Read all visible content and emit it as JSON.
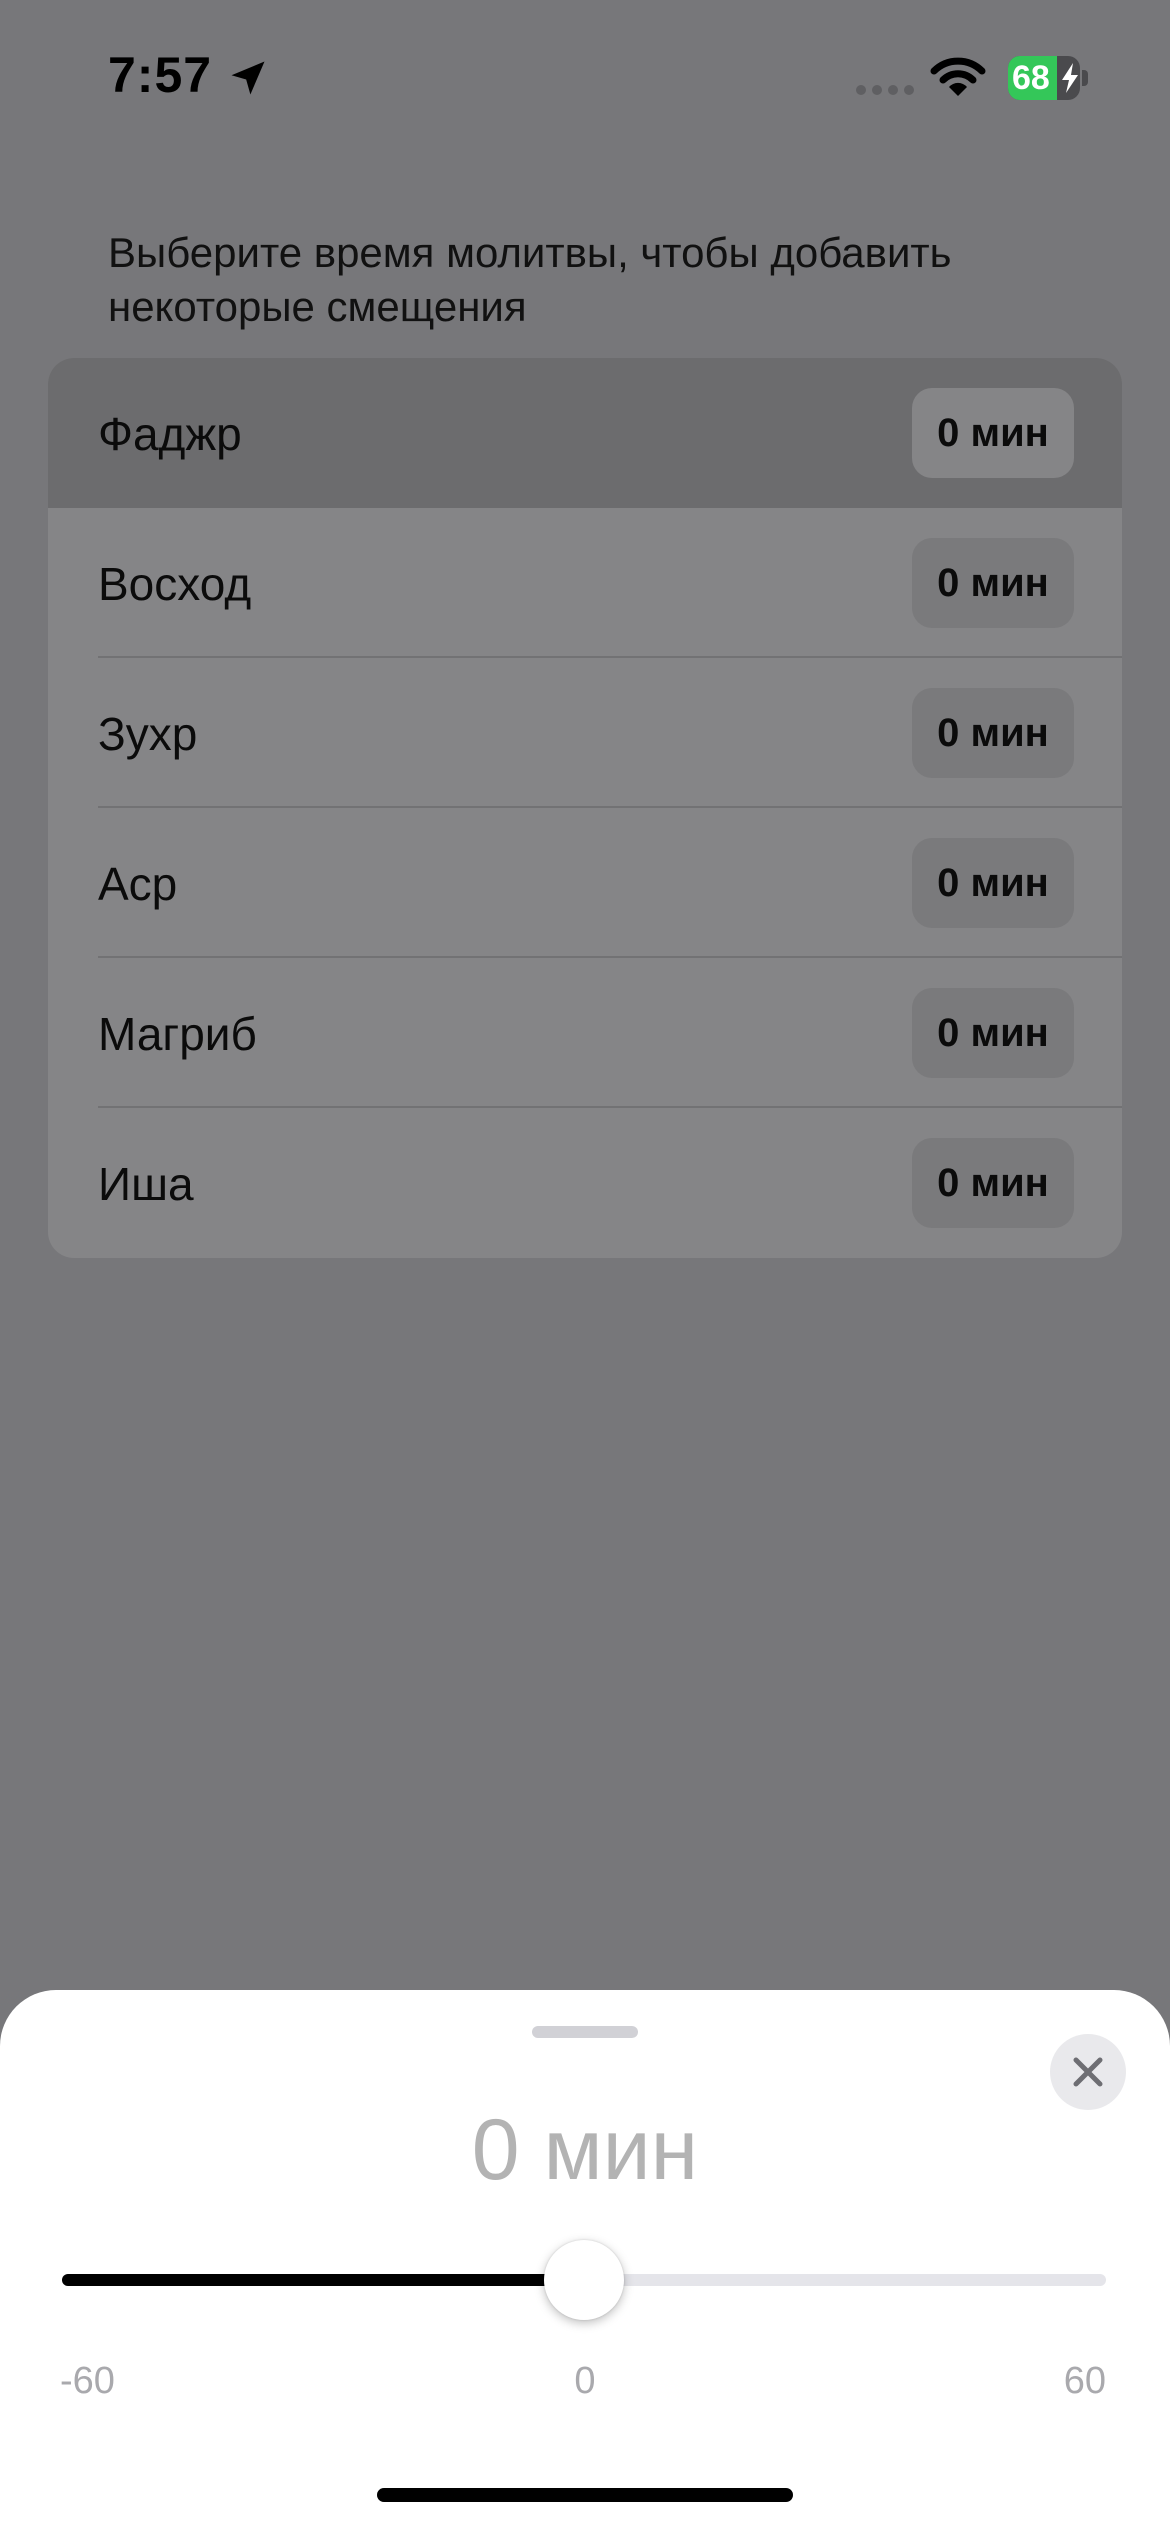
{
  "status_bar": {
    "time": "7:57",
    "battery_level": "68",
    "battery_fraction": 0.68,
    "icons": [
      "location-arrow-icon",
      "signal-icon",
      "wifi-icon",
      "battery-icon",
      "charging-bolt-icon"
    ]
  },
  "instruction": "Выберите время молитвы, чтобы добавить некоторые смещения",
  "prayers": [
    {
      "name": "Фаджр",
      "offset": "0 мин",
      "selected": true
    },
    {
      "name": "Восход",
      "offset": "0 мин",
      "selected": false
    },
    {
      "name": "Зухр",
      "offset": "0 мин",
      "selected": false
    },
    {
      "name": "Аср",
      "offset": "0 мин",
      "selected": false
    },
    {
      "name": "Магриб",
      "offset": "0 мин",
      "selected": false
    },
    {
      "name": "Иша",
      "offset": "0 мин",
      "selected": false
    }
  ],
  "sheet": {
    "value": "0 мин",
    "close_icon": "close-icon",
    "slider": {
      "min": -60,
      "max": 60,
      "value": 0,
      "min_label": "-60",
      "mid_label": "0",
      "max_label": "60"
    }
  },
  "colors": {
    "slider_fill": "#000000",
    "slider_track": "#e5e5ea",
    "battery_fill": "#34c759"
  }
}
